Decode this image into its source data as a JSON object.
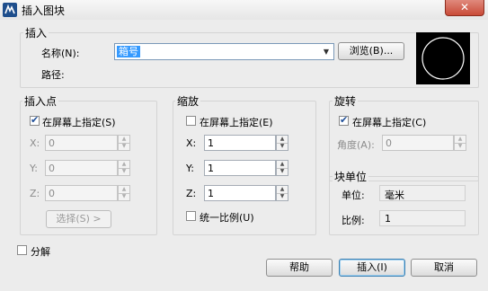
{
  "window": {
    "title": "插入图块",
    "close_symbol": "✕"
  },
  "insert_group": {
    "title": "插入",
    "name_label": "名称(N):",
    "name_value": "箱号",
    "browse_label": "浏览(B)...",
    "path_label": "路径:"
  },
  "insertion_point": {
    "title": "插入点",
    "specify_label": "在屏幕上指定(S)",
    "specify_checked": true,
    "x_label": "X:",
    "x_value": "0",
    "y_label": "Y:",
    "y_value": "0",
    "z_label": "Z:",
    "z_value": "0",
    "select_label": "选择(S) >"
  },
  "scale": {
    "title": "缩放",
    "specify_label": "在屏幕上指定(E)",
    "specify_checked": false,
    "x_label": "X:",
    "x_value": "1",
    "y_label": "Y:",
    "y_value": "1",
    "z_label": "Z:",
    "z_value": "1",
    "uniform_label": "统一比例(U)",
    "uniform_checked": false
  },
  "rotation": {
    "title": "旋转",
    "specify_label": "在屏幕上指定(C)",
    "specify_checked": true,
    "angle_label": "角度(A):",
    "angle_value": "0"
  },
  "block_unit": {
    "title": "块单位",
    "unit_label": "单位:",
    "unit_value": "毫米",
    "ratio_label": "比例:",
    "ratio_value": "1"
  },
  "explode": {
    "label": "分解",
    "checked": false
  },
  "buttons": {
    "help": "帮助",
    "insert": "插入(I)",
    "cancel": "取消"
  },
  "colors": {
    "selection": "#3399ff",
    "check_mark": "#1f4f99",
    "preview_bg": "#000000",
    "close_button": "#c94a37"
  }
}
